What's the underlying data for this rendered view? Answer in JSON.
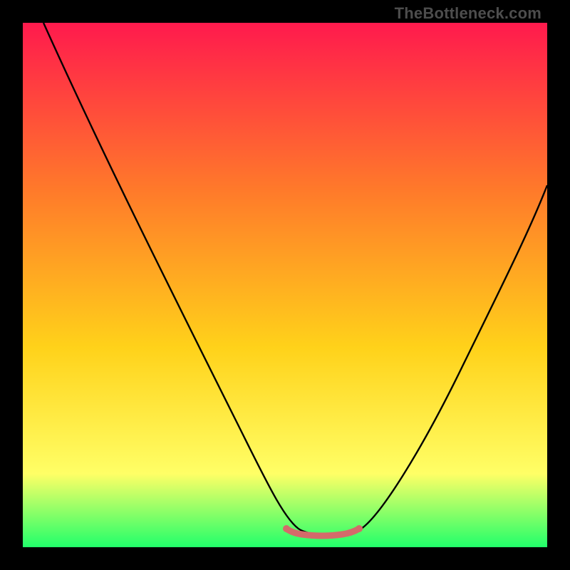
{
  "watermark": "TheBottleneck.com",
  "colors": {
    "frame": "#000000",
    "gradient_top": "#ff1a4d",
    "gradient_mid1": "#ff7a2a",
    "gradient_mid2": "#ffd21a",
    "gradient_mid3": "#ffff66",
    "gradient_bottom": "#21ff6a",
    "curve": "#000000",
    "trough_highlight": "#d46a6a"
  },
  "chart_data": {
    "type": "line",
    "title": "",
    "xlabel": "",
    "ylabel": "",
    "xlim": [
      0,
      100
    ],
    "ylim": [
      0,
      100
    ],
    "series": [
      {
        "name": "black-curve",
        "x": [
          4,
          8,
          12,
          16,
          20,
          24,
          28,
          32,
          36,
          40,
          44,
          48,
          50,
          52,
          54,
          56,
          58,
          60,
          62,
          64,
          68,
          72,
          76,
          80,
          84,
          88,
          92,
          96,
          100
        ],
        "y": [
          100,
          91,
          82,
          74,
          66,
          58,
          50,
          42,
          34,
          27,
          20,
          13,
          10,
          7,
          5,
          4,
          3,
          3,
          3,
          4,
          7,
          12,
          18,
          25,
          33,
          42,
          51,
          60,
          69
        ]
      },
      {
        "name": "trough-highlight",
        "x": [
          50,
          52,
          54,
          56,
          58,
          60,
          62,
          64
        ],
        "y": [
          4.0,
          3.3,
          3.0,
          2.8,
          2.8,
          3.0,
          3.3,
          4.0
        ]
      }
    ],
    "annotations": [
      {
        "text": "TheBottleneck.com",
        "position": "top-right"
      }
    ]
  }
}
